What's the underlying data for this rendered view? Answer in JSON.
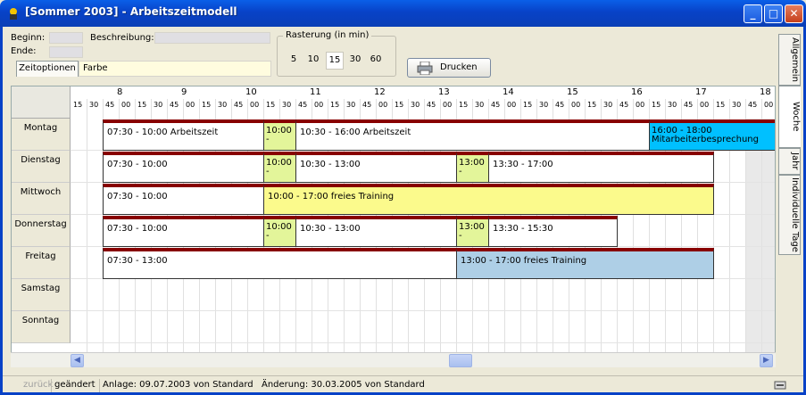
{
  "window": {
    "title": "[Sommer 2003] - Arbeitszeitmodell"
  },
  "form": {
    "beginn_label": "Beginn:",
    "ende_label": "Ende:",
    "beschreibung_label": "Beschreibung:",
    "tab_label": "Zeitoptionen",
    "farbe_value": "Farbe"
  },
  "raster": {
    "caption": "Rasterung (in min)",
    "options": [
      "5",
      "10",
      "15",
      "30",
      "60"
    ],
    "selected": "15"
  },
  "print_label": "Drucken",
  "side_tabs": [
    "Allgemein",
    "Woche",
    "Jahr",
    "Individuelle Tage"
  ],
  "hours": [
    "8",
    "9",
    "10",
    "11",
    "12",
    "13",
    "14",
    "15",
    "16",
    "17",
    "18"
  ],
  "minute_labels": [
    "15",
    "30",
    "45",
    "00"
  ],
  "days": [
    "Montag",
    "Dienstag",
    "Mittwoch",
    "Donnerstag",
    "Freitag",
    "Samstag",
    "Sonntag"
  ],
  "events": [
    {
      "day": 0,
      "start": "07:30",
      "end": "10:00",
      "text": "07:30 - 10:00 Arbeitszeit",
      "kind": "white"
    },
    {
      "day": 0,
      "start": "10:00",
      "end": "10:30",
      "text": "10:00",
      "sub": "-",
      "kind": "small"
    },
    {
      "day": 0,
      "start": "10:30",
      "end": "16:00",
      "text": "10:30 - 16:00 Arbeitszeit",
      "kind": "white"
    },
    {
      "day": 0,
      "start": "16:00",
      "end": "18:00",
      "text": "16:00 - 18:00",
      "sub": "Mitarbeiterbesprechung",
      "kind": "cyan"
    },
    {
      "day": 1,
      "start": "07:30",
      "end": "10:00",
      "text": "07:30 - 10:00",
      "kind": "white"
    },
    {
      "day": 1,
      "start": "10:00",
      "end": "10:30",
      "text": "10:00",
      "sub": "-",
      "kind": "small"
    },
    {
      "day": 1,
      "start": "10:30",
      "end": "13:00",
      "text": "10:30 - 13:00",
      "kind": "white"
    },
    {
      "day": 1,
      "start": "13:00",
      "end": "13:30",
      "text": "13:00",
      "sub": "-",
      "kind": "small"
    },
    {
      "day": 1,
      "start": "13:30",
      "end": "17:00",
      "text": "13:30 - 17:00",
      "kind": "white"
    },
    {
      "day": 2,
      "start": "07:30",
      "end": "10:00",
      "text": "07:30 - 10:00",
      "kind": "white"
    },
    {
      "day": 2,
      "start": "10:00",
      "end": "17:00",
      "text": "10:00 - 17:00 freies Training",
      "kind": "yel"
    },
    {
      "day": 3,
      "start": "07:30",
      "end": "10:00",
      "text": "07:30 - 10:00",
      "kind": "white"
    },
    {
      "day": 3,
      "start": "10:00",
      "end": "10:30",
      "text": "10:00",
      "sub": "-",
      "kind": "small"
    },
    {
      "day": 3,
      "start": "10:30",
      "end": "13:00",
      "text": "10:30 - 13:00",
      "kind": "white"
    },
    {
      "day": 3,
      "start": "13:00",
      "end": "13:30",
      "text": "13:00",
      "sub": "-",
      "kind": "small"
    },
    {
      "day": 3,
      "start": "13:30",
      "end": "15:30",
      "text": "13:30 - 15:30",
      "kind": "white"
    },
    {
      "day": 4,
      "start": "07:30",
      "end": "13:00",
      "text": "07:30 - 13:00",
      "kind": "white"
    },
    {
      "day": 4,
      "start": "13:00",
      "end": "17:00",
      "text": "13:00 - 17:00 freies Training",
      "kind": "blue"
    }
  ],
  "status": {
    "back": "zurück",
    "changed": "geändert",
    "created": "Anlage: 09.07.2003 von Standard",
    "modified": "Änderung: 30.03.2005 von Standard"
  }
}
